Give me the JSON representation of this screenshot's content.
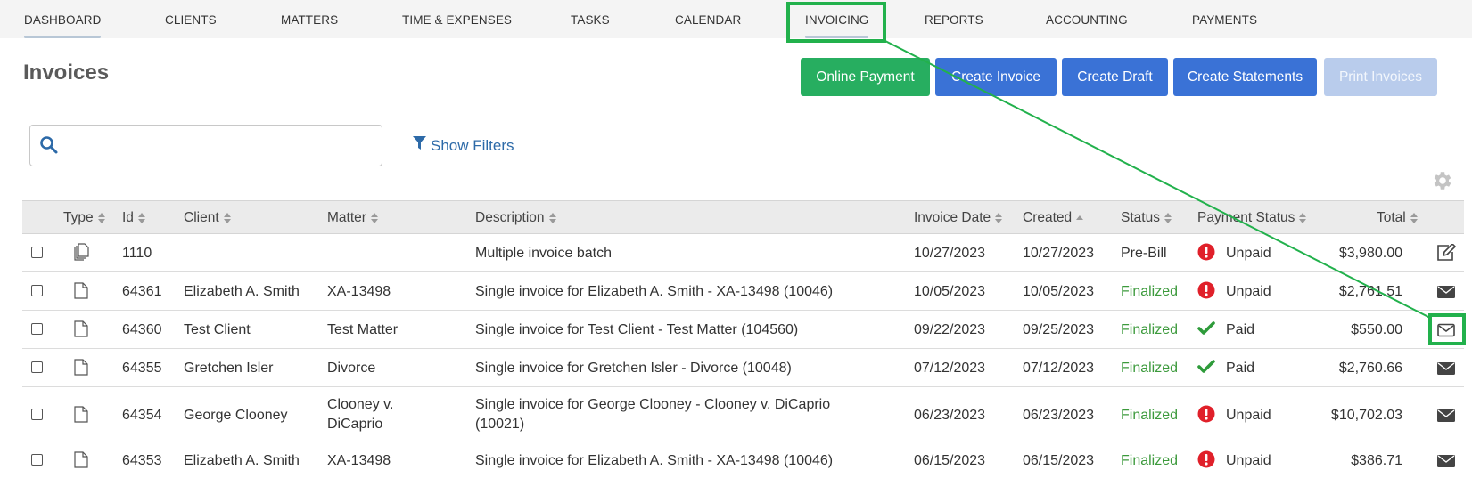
{
  "nav": {
    "items": [
      {
        "label": "DASHBOARD"
      },
      {
        "label": "CLIENTS"
      },
      {
        "label": "MATTERS"
      },
      {
        "label": "TIME & EXPENSES"
      },
      {
        "label": "TASKS"
      },
      {
        "label": "CALENDAR"
      },
      {
        "label": "INVOICING"
      },
      {
        "label": "REPORTS"
      },
      {
        "label": "ACCOUNTING"
      },
      {
        "label": "PAYMENTS"
      }
    ]
  },
  "page": {
    "title": "Invoices"
  },
  "toolbar": {
    "online_payment": "Online Payment",
    "create_invoice": "Create Invoice",
    "create_draft": "Create Draft",
    "create_statements": "Create Statements",
    "print_invoices": "Print Invoices"
  },
  "search": {
    "value": "",
    "placeholder": ""
  },
  "filters": {
    "label": "Show Filters"
  },
  "table": {
    "headers": {
      "type": "Type",
      "id": "Id",
      "client": "Client",
      "matter": "Matter",
      "description": "Description",
      "invoice_date": "Invoice Date",
      "created": "Created",
      "status": "Status",
      "payment_status": "Payment Status",
      "total": "Total"
    },
    "rows": [
      {
        "type_icon": "multiple-documents-icon",
        "id": "1110",
        "client": "",
        "matter": "",
        "description": "Multiple invoice batch",
        "description2": "",
        "invoice_date": "10/27/2023",
        "created": "10/27/2023",
        "status": "Pre-Bill",
        "payment_status": "Unpaid",
        "payment_icon": "alert-icon",
        "total": "$3,980.00",
        "action_icon": "edit-icon"
      },
      {
        "type_icon": "document-icon",
        "id": "64361",
        "client": "Elizabeth A. Smith",
        "matter": "XA-13498",
        "description": "Single invoice for Elizabeth A. Smith - XA-13498 (10046)",
        "description2": "",
        "invoice_date": "10/05/2023",
        "created": "10/05/2023",
        "status": "Finalized",
        "payment_status": "Unpaid",
        "payment_icon": "alert-icon",
        "total": "$2,761.51",
        "action_icon": "envelope-icon"
      },
      {
        "type_icon": "document-icon",
        "id": "64360",
        "client": "Test Client",
        "matter": "Test Matter",
        "description": "Single invoice for Test Client - Test Matter (104560)",
        "description2": "",
        "invoice_date": "09/22/2023",
        "created": "09/25/2023",
        "status": "Finalized",
        "payment_status": "Paid",
        "payment_icon": "check-icon",
        "total": "$550.00",
        "action_icon": "envelope-outline-icon"
      },
      {
        "type_icon": "document-icon",
        "id": "64355",
        "client": "Gretchen Isler",
        "matter": "Divorce",
        "description": "Single invoice for Gretchen Isler - Divorce (10048)",
        "description2": "",
        "invoice_date": "07/12/2023",
        "created": "07/12/2023",
        "status": "Finalized",
        "payment_status": "Paid",
        "payment_icon": "check-icon",
        "total": "$2,760.66",
        "action_icon": "envelope-icon"
      },
      {
        "type_icon": "document-icon",
        "id": "64354",
        "client": "George Clooney",
        "matter": "Clooney v.",
        "matter2": "DiCaprio",
        "description": "Single invoice for George Clooney - Clooney v. DiCaprio",
        "description2": "(10021)",
        "invoice_date": "06/23/2023",
        "created": "06/23/2023",
        "status": "Finalized",
        "payment_status": "Unpaid",
        "payment_icon": "alert-icon",
        "total": "$10,702.03",
        "action_icon": "envelope-icon"
      },
      {
        "type_icon": "document-icon",
        "id": "64353",
        "client": "Elizabeth A. Smith",
        "matter": "XA-13498",
        "description": "Single invoice for Elizabeth A. Smith - XA-13498 (10046)",
        "description2": "",
        "invoice_date": "06/15/2023",
        "created": "06/15/2023",
        "status": "Finalized",
        "payment_status": "Unpaid",
        "payment_icon": "alert-icon",
        "total": "$386.71",
        "action_icon": "envelope-icon"
      }
    ]
  },
  "colors": {
    "green_button": "#27ae60",
    "blue_button": "#3a72d6",
    "disabled_button": "#b9ccec",
    "finalized_text": "#3c9a3c",
    "unpaid_icon": "#e0202a",
    "paid_icon": "#2e9b3a",
    "annotation": "#22b14c"
  }
}
